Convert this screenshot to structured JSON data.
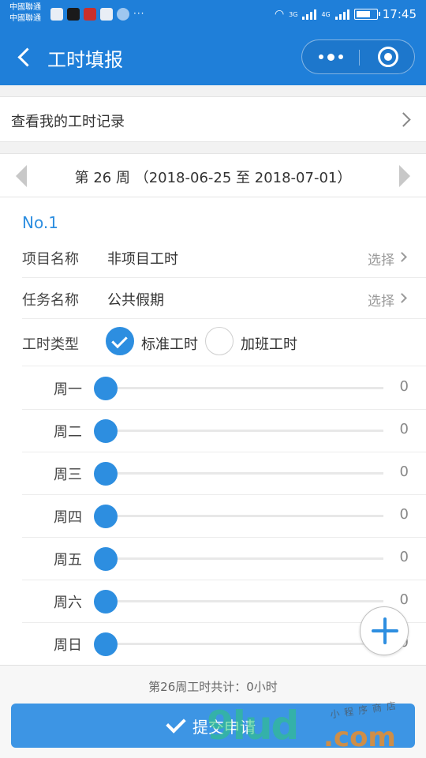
{
  "status_bar": {
    "carrier_1": "中國聯通",
    "carrier_2": "中國聯通",
    "more": "···",
    "net_1": "3G",
    "net_2": "4G",
    "time": "17:45"
  },
  "nav": {
    "title": "工时填报"
  },
  "records_link": {
    "label": "查看我的工时记录"
  },
  "week": {
    "label": "第 26 周 （2018-06-25 至 2018-07-01）"
  },
  "entry": {
    "number": "No.1",
    "project_label": "项目名称",
    "project_value": "非项目工时",
    "project_pick": "选择",
    "task_label": "任务名称",
    "task_value": "公共假期",
    "task_pick": "选择",
    "type_label": "工时类型",
    "type_options": [
      {
        "label": "标准工时",
        "checked": true
      },
      {
        "label": "加班工时",
        "checked": false
      }
    ],
    "days": [
      {
        "label": "周一",
        "value": "0"
      },
      {
        "label": "周二",
        "value": "0"
      },
      {
        "label": "周三",
        "value": "0"
      },
      {
        "label": "周四",
        "value": "0"
      },
      {
        "label": "周五",
        "value": "0"
      },
      {
        "label": "周六",
        "value": "0"
      },
      {
        "label": "周日",
        "value": "0"
      }
    ]
  },
  "footer": {
    "total": "第26周工时共计：0小时",
    "submit_label": "提交申请"
  },
  "watermark": {
    "main": "9lud",
    "domain": ".com",
    "tagline": "小程序商店"
  },
  "colors": {
    "primary": "#1f7fd9",
    "accent": "#2d8ee0",
    "button": "#3d95e4"
  }
}
